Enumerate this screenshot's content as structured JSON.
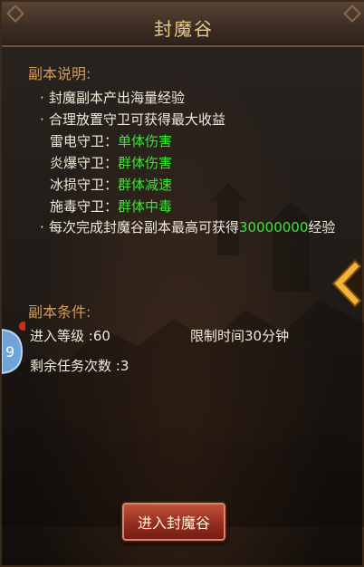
{
  "title": "封魔谷",
  "description": {
    "heading": "副本说明:",
    "bullet_char": "·",
    "line1": "封魔副本产出海量经验",
    "line2": "合理放置守卫可获得最大收益",
    "guards": [
      {
        "name": "雷电守卫：",
        "effect": "单体伤害"
      },
      {
        "name": "炎爆守卫：",
        "effect": "群体伤害"
      },
      {
        "name": "冰损守卫：",
        "effect": "群体减速"
      },
      {
        "name": "施毒守卫：",
        "effect": "群体中毒"
      }
    ],
    "reward_prefix": "每次完成封魔谷副本最高可获得",
    "reward_value": "30000000",
    "reward_suffix": "经验"
  },
  "conditions": {
    "heading": "副本条件:",
    "level_label": "进入等级",
    "level_value": ":60",
    "time_limit": "限制时间30分钟",
    "remaining_label": "剩余任务次数",
    "remaining_value": ":3"
  },
  "enter_button": "进入封魔谷",
  "colors": {
    "heading": "#d59a54",
    "text": "#f0ead8",
    "highlight": "#3fe23a",
    "button": "#9a2f20"
  },
  "icons": [
    "side-arrow-icon",
    "badge-icon"
  ]
}
